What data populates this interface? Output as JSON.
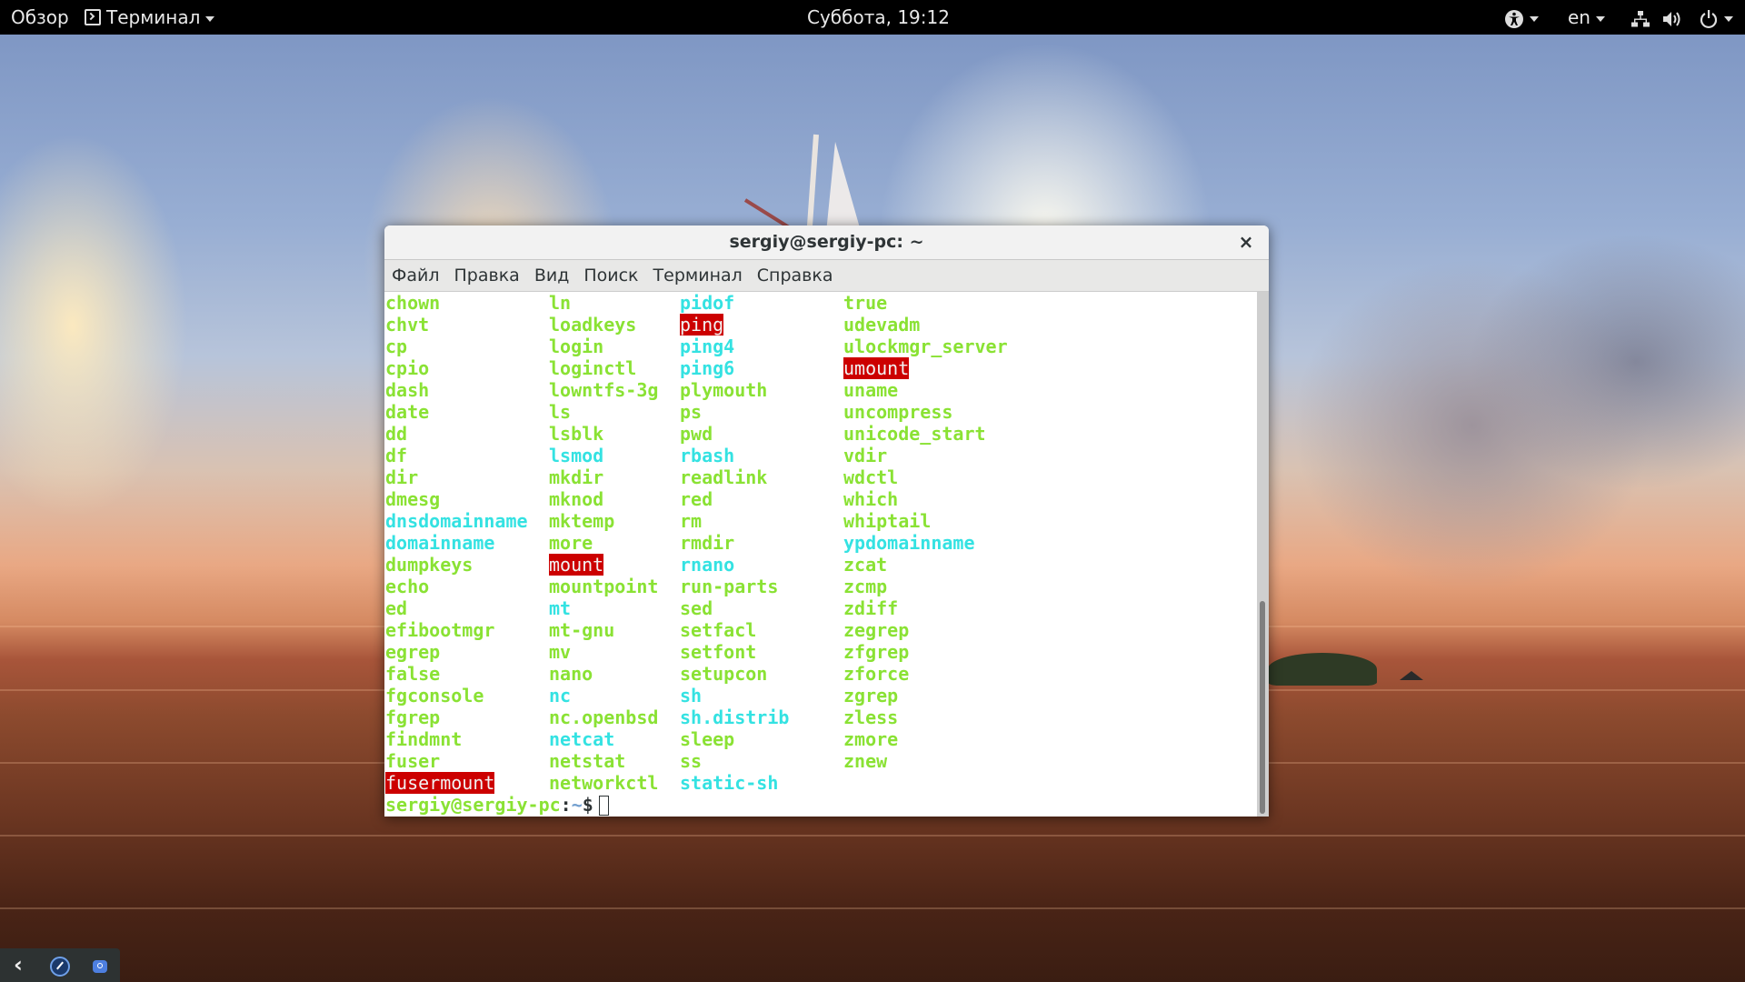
{
  "topbar": {
    "activities_label": "Обзор",
    "app_menu_label": "Терминал",
    "app_icon": "terminal-icon",
    "clock": "Суббота, 19:12",
    "accessibility_icon": "accessibility-icon",
    "keyboard_layout": "en",
    "network_icon": "network-wired-icon",
    "volume_icon": "volume-icon",
    "power_icon": "power-icon"
  },
  "window": {
    "title": "sergiy@sergiy-pc: ~",
    "close_glyph": "×",
    "menu": [
      "Файл",
      "Правка",
      "Вид",
      "Поиск",
      "Терминал",
      "Справка"
    ]
  },
  "terminal": {
    "colors": {
      "executable": "#8ae234",
      "symlink": "#34e2e2",
      "setuid_bg": "#cc0000",
      "setuid_fg": "#f2f2f2",
      "prompt_user": "#8ae234",
      "prompt_path": "#729fcf"
    },
    "columns": [
      [
        {
          "name": "chown",
          "type": "exec"
        },
        {
          "name": "chvt",
          "type": "exec"
        },
        {
          "name": "cp",
          "type": "exec"
        },
        {
          "name": "cpio",
          "type": "exec"
        },
        {
          "name": "dash",
          "type": "exec"
        },
        {
          "name": "date",
          "type": "exec"
        },
        {
          "name": "dd",
          "type": "exec"
        },
        {
          "name": "df",
          "type": "exec"
        },
        {
          "name": "dir",
          "type": "exec"
        },
        {
          "name": "dmesg",
          "type": "exec"
        },
        {
          "name": "dnsdomainname",
          "type": "link"
        },
        {
          "name": "domainname",
          "type": "link"
        },
        {
          "name": "dumpkeys",
          "type": "exec"
        },
        {
          "name": "echo",
          "type": "exec"
        },
        {
          "name": "ed",
          "type": "exec"
        },
        {
          "name": "efibootmgr",
          "type": "exec"
        },
        {
          "name": "egrep",
          "type": "exec"
        },
        {
          "name": "false",
          "type": "exec"
        },
        {
          "name": "fgconsole",
          "type": "exec"
        },
        {
          "name": "fgrep",
          "type": "exec"
        },
        {
          "name": "findmnt",
          "type": "exec"
        },
        {
          "name": "fuser",
          "type": "exec"
        },
        {
          "name": "fusermount",
          "type": "setuid"
        }
      ],
      [
        {
          "name": "ln",
          "type": "exec"
        },
        {
          "name": "loadkeys",
          "type": "exec"
        },
        {
          "name": "login",
          "type": "exec"
        },
        {
          "name": "loginctl",
          "type": "exec"
        },
        {
          "name": "lowntfs-3g",
          "type": "exec"
        },
        {
          "name": "ls",
          "type": "exec"
        },
        {
          "name": "lsblk",
          "type": "exec"
        },
        {
          "name": "lsmod",
          "type": "link"
        },
        {
          "name": "mkdir",
          "type": "exec"
        },
        {
          "name": "mknod",
          "type": "exec"
        },
        {
          "name": "mktemp",
          "type": "exec"
        },
        {
          "name": "more",
          "type": "exec"
        },
        {
          "name": "mount",
          "type": "setuid"
        },
        {
          "name": "mountpoint",
          "type": "exec"
        },
        {
          "name": "mt",
          "type": "link"
        },
        {
          "name": "mt-gnu",
          "type": "exec"
        },
        {
          "name": "mv",
          "type": "exec"
        },
        {
          "name": "nano",
          "type": "exec"
        },
        {
          "name": "nc",
          "type": "link"
        },
        {
          "name": "nc.openbsd",
          "type": "exec"
        },
        {
          "name": "netcat",
          "type": "link"
        },
        {
          "name": "netstat",
          "type": "exec"
        },
        {
          "name": "networkctl",
          "type": "exec"
        }
      ],
      [
        {
          "name": "pidof",
          "type": "link"
        },
        {
          "name": "ping",
          "type": "setuid"
        },
        {
          "name": "ping4",
          "type": "link"
        },
        {
          "name": "ping6",
          "type": "link"
        },
        {
          "name": "plymouth",
          "type": "exec"
        },
        {
          "name": "ps",
          "type": "exec"
        },
        {
          "name": "pwd",
          "type": "exec"
        },
        {
          "name": "rbash",
          "type": "link"
        },
        {
          "name": "readlink",
          "type": "exec"
        },
        {
          "name": "red",
          "type": "exec"
        },
        {
          "name": "rm",
          "type": "exec"
        },
        {
          "name": "rmdir",
          "type": "exec"
        },
        {
          "name": "rnano",
          "type": "link"
        },
        {
          "name": "run-parts",
          "type": "exec"
        },
        {
          "name": "sed",
          "type": "exec"
        },
        {
          "name": "setfacl",
          "type": "exec"
        },
        {
          "name": "setfont",
          "type": "exec"
        },
        {
          "name": "setupcon",
          "type": "exec"
        },
        {
          "name": "sh",
          "type": "link"
        },
        {
          "name": "sh.distrib",
          "type": "link"
        },
        {
          "name": "sleep",
          "type": "exec"
        },
        {
          "name": "ss",
          "type": "exec"
        },
        {
          "name": "static-sh",
          "type": "link"
        }
      ],
      [
        {
          "name": "true",
          "type": "exec"
        },
        {
          "name": "udevadm",
          "type": "exec"
        },
        {
          "name": "ulockmgr_server",
          "type": "exec"
        },
        {
          "name": "umount",
          "type": "setuid"
        },
        {
          "name": "uname",
          "type": "exec"
        },
        {
          "name": "uncompress",
          "type": "exec"
        },
        {
          "name": "unicode_start",
          "type": "exec"
        },
        {
          "name": "vdir",
          "type": "exec"
        },
        {
          "name": "wdctl",
          "type": "exec"
        },
        {
          "name": "which",
          "type": "exec"
        },
        {
          "name": "whiptail",
          "type": "exec"
        },
        {
          "name": "ypdomainname",
          "type": "link"
        },
        {
          "name": "zcat",
          "type": "exec"
        },
        {
          "name": "zcmp",
          "type": "exec"
        },
        {
          "name": "zdiff",
          "type": "exec"
        },
        {
          "name": "zegrep",
          "type": "exec"
        },
        {
          "name": "zfgrep",
          "type": "exec"
        },
        {
          "name": "zforce",
          "type": "exec"
        },
        {
          "name": "zgrep",
          "type": "exec"
        },
        {
          "name": "zless",
          "type": "exec"
        },
        {
          "name": "zmore",
          "type": "exec"
        },
        {
          "name": "znew",
          "type": "exec"
        }
      ]
    ],
    "prompt": {
      "user_host": "sergiy@sergiy-pc",
      "separator": ":",
      "path": "~",
      "symbol": "$"
    },
    "scroll_position_fraction": 1.0,
    "scroll_visible_fraction": 0.41
  },
  "tray": {
    "items": [
      "chevron-left-icon",
      "browser-compass-icon",
      "chat-icon"
    ]
  }
}
